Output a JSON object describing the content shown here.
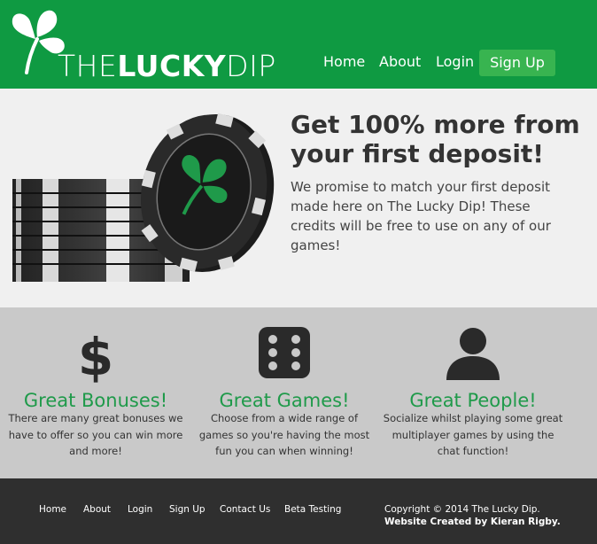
{
  "header": {
    "logo": {
      "part1": "THE",
      "part2": "LUCKY",
      "part3": "DIP"
    },
    "nav": [
      {
        "label": "Home"
      },
      {
        "label": "About"
      },
      {
        "label": "Login"
      }
    ],
    "signup_label": "Sign Up",
    "brand_color": "#0f9a42",
    "button_color": "#38b450"
  },
  "hero": {
    "title": "Get 100% more from your first deposit!",
    "body": "We promise to match your first deposit made here on The Lucky Dip! These credits will be free to use on any of our games!",
    "image": "poker-chips-with-clover"
  },
  "features": [
    {
      "icon": "dollar-icon",
      "title": "Great Bonuses!",
      "text": "There are many great bonuses we have to offer so you can win more and more!"
    },
    {
      "icon": "dice-icon",
      "title": "Great Games!",
      "text": "Choose from a wide range of games so you're having the most fun you can when winning!"
    },
    {
      "icon": "person-icon",
      "title": "Great People!",
      "text": "Socialize whilst playing some great multiplayer games by using the chat function!"
    }
  ],
  "footer": {
    "links": [
      "Home",
      "About",
      "Login",
      "Sign Up",
      "Contact Us",
      "Beta Testing"
    ],
    "copyright": "Copyright © 2014 The Lucky Dip.",
    "credit": "Website Created by Kieran Rigby."
  }
}
